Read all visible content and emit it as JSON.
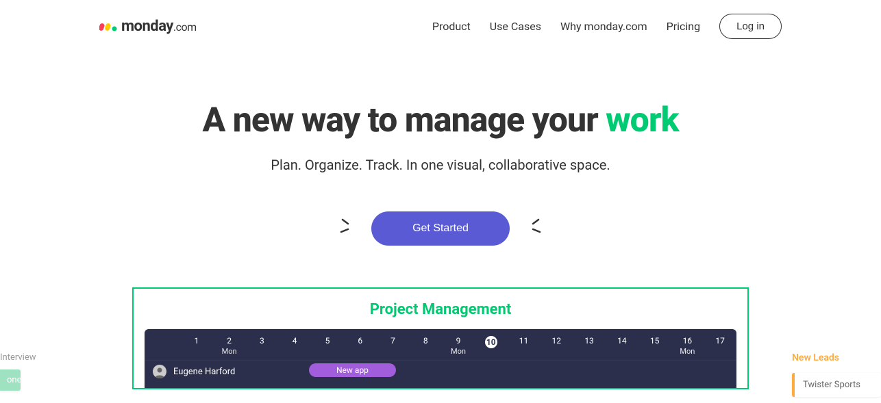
{
  "brand": {
    "name": "monday",
    "suffix": ".com"
  },
  "nav": {
    "items": [
      "Product",
      "Use Cases",
      "Why monday.com",
      "Pricing"
    ],
    "login": "Log in"
  },
  "hero": {
    "title_prefix": "A new way to manage your ",
    "title_accent": "work",
    "subtitle": "Plan. Organize. Track. In one visual, collaborative space.",
    "cta": "Get Started"
  },
  "panel": {
    "title": "Project Management",
    "days": [
      {
        "num": "1",
        "lbl": ""
      },
      {
        "num": "2",
        "lbl": "Mon"
      },
      {
        "num": "3",
        "lbl": ""
      },
      {
        "num": "4",
        "lbl": ""
      },
      {
        "num": "5",
        "lbl": ""
      },
      {
        "num": "6",
        "lbl": ""
      },
      {
        "num": "7",
        "lbl": ""
      },
      {
        "num": "8",
        "lbl": ""
      },
      {
        "num": "9",
        "lbl": "Mon"
      },
      {
        "num": "10",
        "lbl": "",
        "today": true
      },
      {
        "num": "11",
        "lbl": ""
      },
      {
        "num": "12",
        "lbl": ""
      },
      {
        "num": "13",
        "lbl": ""
      },
      {
        "num": "14",
        "lbl": ""
      },
      {
        "num": "15",
        "lbl": ""
      },
      {
        "num": "16",
        "lbl": "Mon"
      },
      {
        "num": "17",
        "lbl": ""
      }
    ],
    "row": {
      "person": "Eugene Harford",
      "bar_label": "New app"
    }
  },
  "side_left": {
    "heading": "Interview",
    "pill": "one"
  },
  "side_right": {
    "heading": "New Leads",
    "card": "Twister Sports"
  }
}
